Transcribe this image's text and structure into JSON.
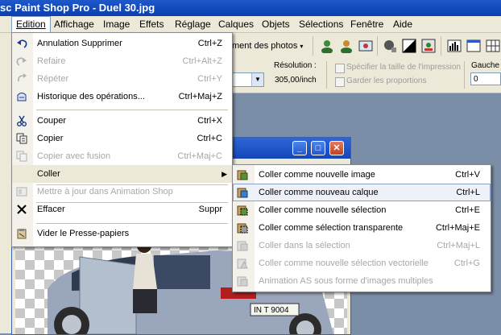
{
  "window": {
    "title": "sc Paint Shop Pro - Duel 30.jpg"
  },
  "menubar": [
    {
      "label": "Edition",
      "active": true
    },
    {
      "label": "Affichage"
    },
    {
      "label": "Image"
    },
    {
      "label": "Effets"
    },
    {
      "label": "Réglage"
    },
    {
      "label": "Calques"
    },
    {
      "label": "Objets"
    },
    {
      "label": "Sélections"
    },
    {
      "label": "Fenêtre"
    },
    {
      "label": "Aide"
    }
  ],
  "toolbar": {
    "photos_button": "ment des photos",
    "resolution_label": "Résolution :",
    "resolution_value": "305,00/inch",
    "option_print_size": "Spécifier la taille de l'impression",
    "option_keep_proportions": "Garder les proportions",
    "gauche_label": "Gauche",
    "gauche_value": "0"
  },
  "edit_menu": {
    "items": [
      {
        "label": "Annulation Supprimer",
        "shortcut": "Ctrl+Z",
        "icon": "undo-icon",
        "disabled": false
      },
      {
        "label": "Refaire",
        "shortcut": "Ctrl+Alt+Z",
        "icon": "redo-icon",
        "disabled": true
      },
      {
        "label": "Répéter",
        "shortcut": "Ctrl+Y",
        "icon": "repeat-icon",
        "disabled": true
      },
      {
        "label": "Historique des opérations...",
        "shortcut": "Ctrl+Maj+Z",
        "icon": "history-icon",
        "disabled": false
      },
      {
        "label": "Couper",
        "shortcut": "Ctrl+X",
        "icon": "scissors-icon",
        "disabled": false
      },
      {
        "label": "Copier",
        "shortcut": "Ctrl+C",
        "icon": "copy-icon",
        "disabled": false
      },
      {
        "label": "Copier avec fusion",
        "shortcut": "Ctrl+Maj+C",
        "icon": "copy-merged-icon",
        "disabled": true
      },
      {
        "label": "Coller",
        "shortcut": "",
        "icon": "",
        "disabled": false,
        "submenu": true
      },
      {
        "label": "Mettre à jour dans Animation Shop",
        "shortcut": "",
        "icon": "animation-shop-icon",
        "disabled": true
      },
      {
        "label": "Effacer",
        "shortcut": "Suppr",
        "icon": "clear-icon",
        "disabled": false
      },
      {
        "label": "Vider le Presse-papiers",
        "shortcut": "",
        "icon": "empty-clipboard-icon",
        "disabled": false
      }
    ]
  },
  "paste_submenu": {
    "items": [
      {
        "label": "Coller comme nouvelle image",
        "shortcut": "Ctrl+V",
        "disabled": false
      },
      {
        "label": "Coller comme nouveau calque",
        "shortcut": "Ctrl+L",
        "disabled": false,
        "hover": true
      },
      {
        "label": "Coller comme nouvelle sélection",
        "shortcut": "Ctrl+E",
        "disabled": false
      },
      {
        "label": "Coller comme sélection transparente",
        "shortcut": "Ctrl+Maj+E",
        "disabled": false
      },
      {
        "label": "Coller dans la sélection",
        "shortcut": "Ctrl+Maj+L",
        "disabled": true
      },
      {
        "label": "Coller comme nouvelle sélection vectorielle",
        "shortcut": "Ctrl+G",
        "disabled": true
      },
      {
        "label": "Animation AS sous forme d'images multiples",
        "shortcut": "",
        "disabled": true
      }
    ]
  },
  "image": {
    "plate_text": "IN T 9004"
  },
  "colors": {
    "titlebar": "#0a3fb0",
    "menu_highlight": "#ece9d8",
    "submenu_hover": "#eef1f8"
  }
}
